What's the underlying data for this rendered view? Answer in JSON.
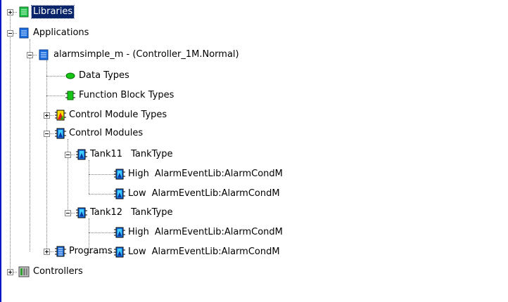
{
  "tree": {
    "libraries": "Libraries",
    "applications": "Applications",
    "app_node": "alarmsimple_m - (Controller_1M.Normal)",
    "data_types": "Data Types",
    "function_block_types": "Function Block Types",
    "control_module_types": "Control Module Types",
    "control_modules": "Control Modules",
    "tank11": {
      "name": "Tank11",
      "type": "TankType",
      "children": [
        {
          "name": "High",
          "type": "AlarmEventLib:AlarmCondM"
        },
        {
          "name": "Low",
          "type": "AlarmEventLib:AlarmCondM"
        }
      ]
    },
    "tank12": {
      "name": "Tank12",
      "type": "TankType",
      "children": [
        {
          "name": "High",
          "type": "AlarmEventLib:AlarmCondM"
        },
        {
          "name": "Low",
          "type": "AlarmEventLib:AlarmCondM"
        }
      ]
    },
    "programs": "Programs",
    "controllers": "Controllers"
  },
  "colors": {
    "selection": "#0a246a",
    "edge": "#0018c8",
    "library_icon": "#22c34a",
    "document_icon": "#1c6fe0"
  }
}
